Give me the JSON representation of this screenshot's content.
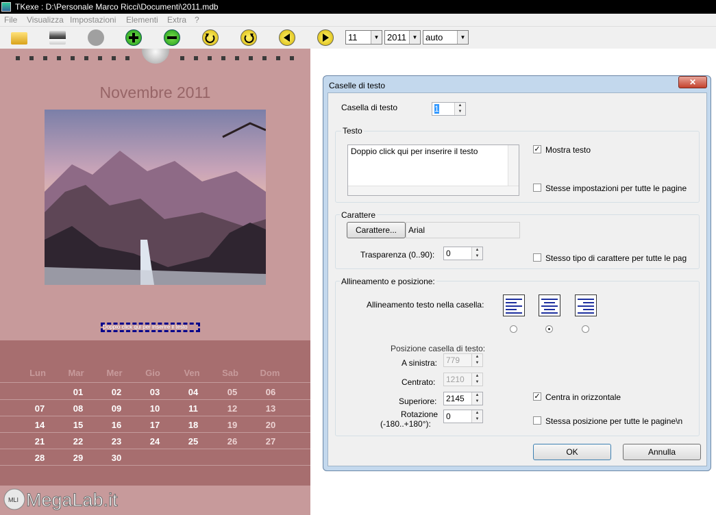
{
  "window": {
    "title": "TKexe : D:\\Personale Marco Ricci\\Documenti\\2011.mdb"
  },
  "menu": [
    "File",
    "Visualizza",
    "Impostazioni",
    "Elementi",
    "Extra",
    "?"
  ],
  "toolbar": {
    "month_value": "11",
    "year_value": "2011",
    "zoom_value": "auto"
  },
  "calendar": {
    "title": "Novembre 2011",
    "textbox_text": "Doppio click qui per inserire il testo",
    "weekdays": [
      "Lun",
      "Mar",
      "Mer",
      "Gio",
      "Ven",
      "Sab",
      "Dom"
    ],
    "weeks": [
      [
        "",
        "01",
        "02",
        "03",
        "04",
        "05",
        "06"
      ],
      [
        "07",
        "08",
        "09",
        "10",
        "11",
        "12",
        "13"
      ],
      [
        "14",
        "15",
        "16",
        "17",
        "18",
        "19",
        "20"
      ],
      [
        "21",
        "22",
        "23",
        "24",
        "25",
        "26",
        "27"
      ],
      [
        "28",
        "29",
        "30",
        "",
        "",
        "",
        ""
      ]
    ]
  },
  "watermark": "MegaLab.it",
  "dialog": {
    "title": "Caselle di testo",
    "casella_label": "Casella di testo",
    "casella_value": "1",
    "testo_group": "Testo",
    "testo_value": "Doppio click qui per inserire il testo",
    "mostra_testo": "Mostra testo",
    "stesse_impostazioni": "Stesse impostazioni per tutte le pagine",
    "carattere_group": "Carattere",
    "carattere_button": "Carattere...",
    "font_name": "Arial",
    "trasparenza_label": "Trasparenza (0..90):",
    "trasparenza_value": "0",
    "stesso_tipo": "Stesso tipo di carattere per tutte le pag",
    "allineamento_group": "Allineamento e posizione:",
    "allineamento_label": "Allineamento testo nella casella:",
    "posizione_label": "Posizione casella di testo:",
    "sinistra_label": "A sinistra:",
    "sinistra_value": "779",
    "centrato_label": "Centrato:",
    "centrato_value": "1210",
    "superiore_label": "Superiore:",
    "superiore_value": "2145",
    "rotazione_label1": "Rotazione",
    "rotazione_label2": "(-180..+180°):",
    "rotazione_value": "0",
    "centra_orizzontale": "Centra in orizzontale",
    "stessa_posizione": "Stessa posizione per tutte le pagine\\n",
    "ok": "OK",
    "annulla": "Annulla"
  }
}
